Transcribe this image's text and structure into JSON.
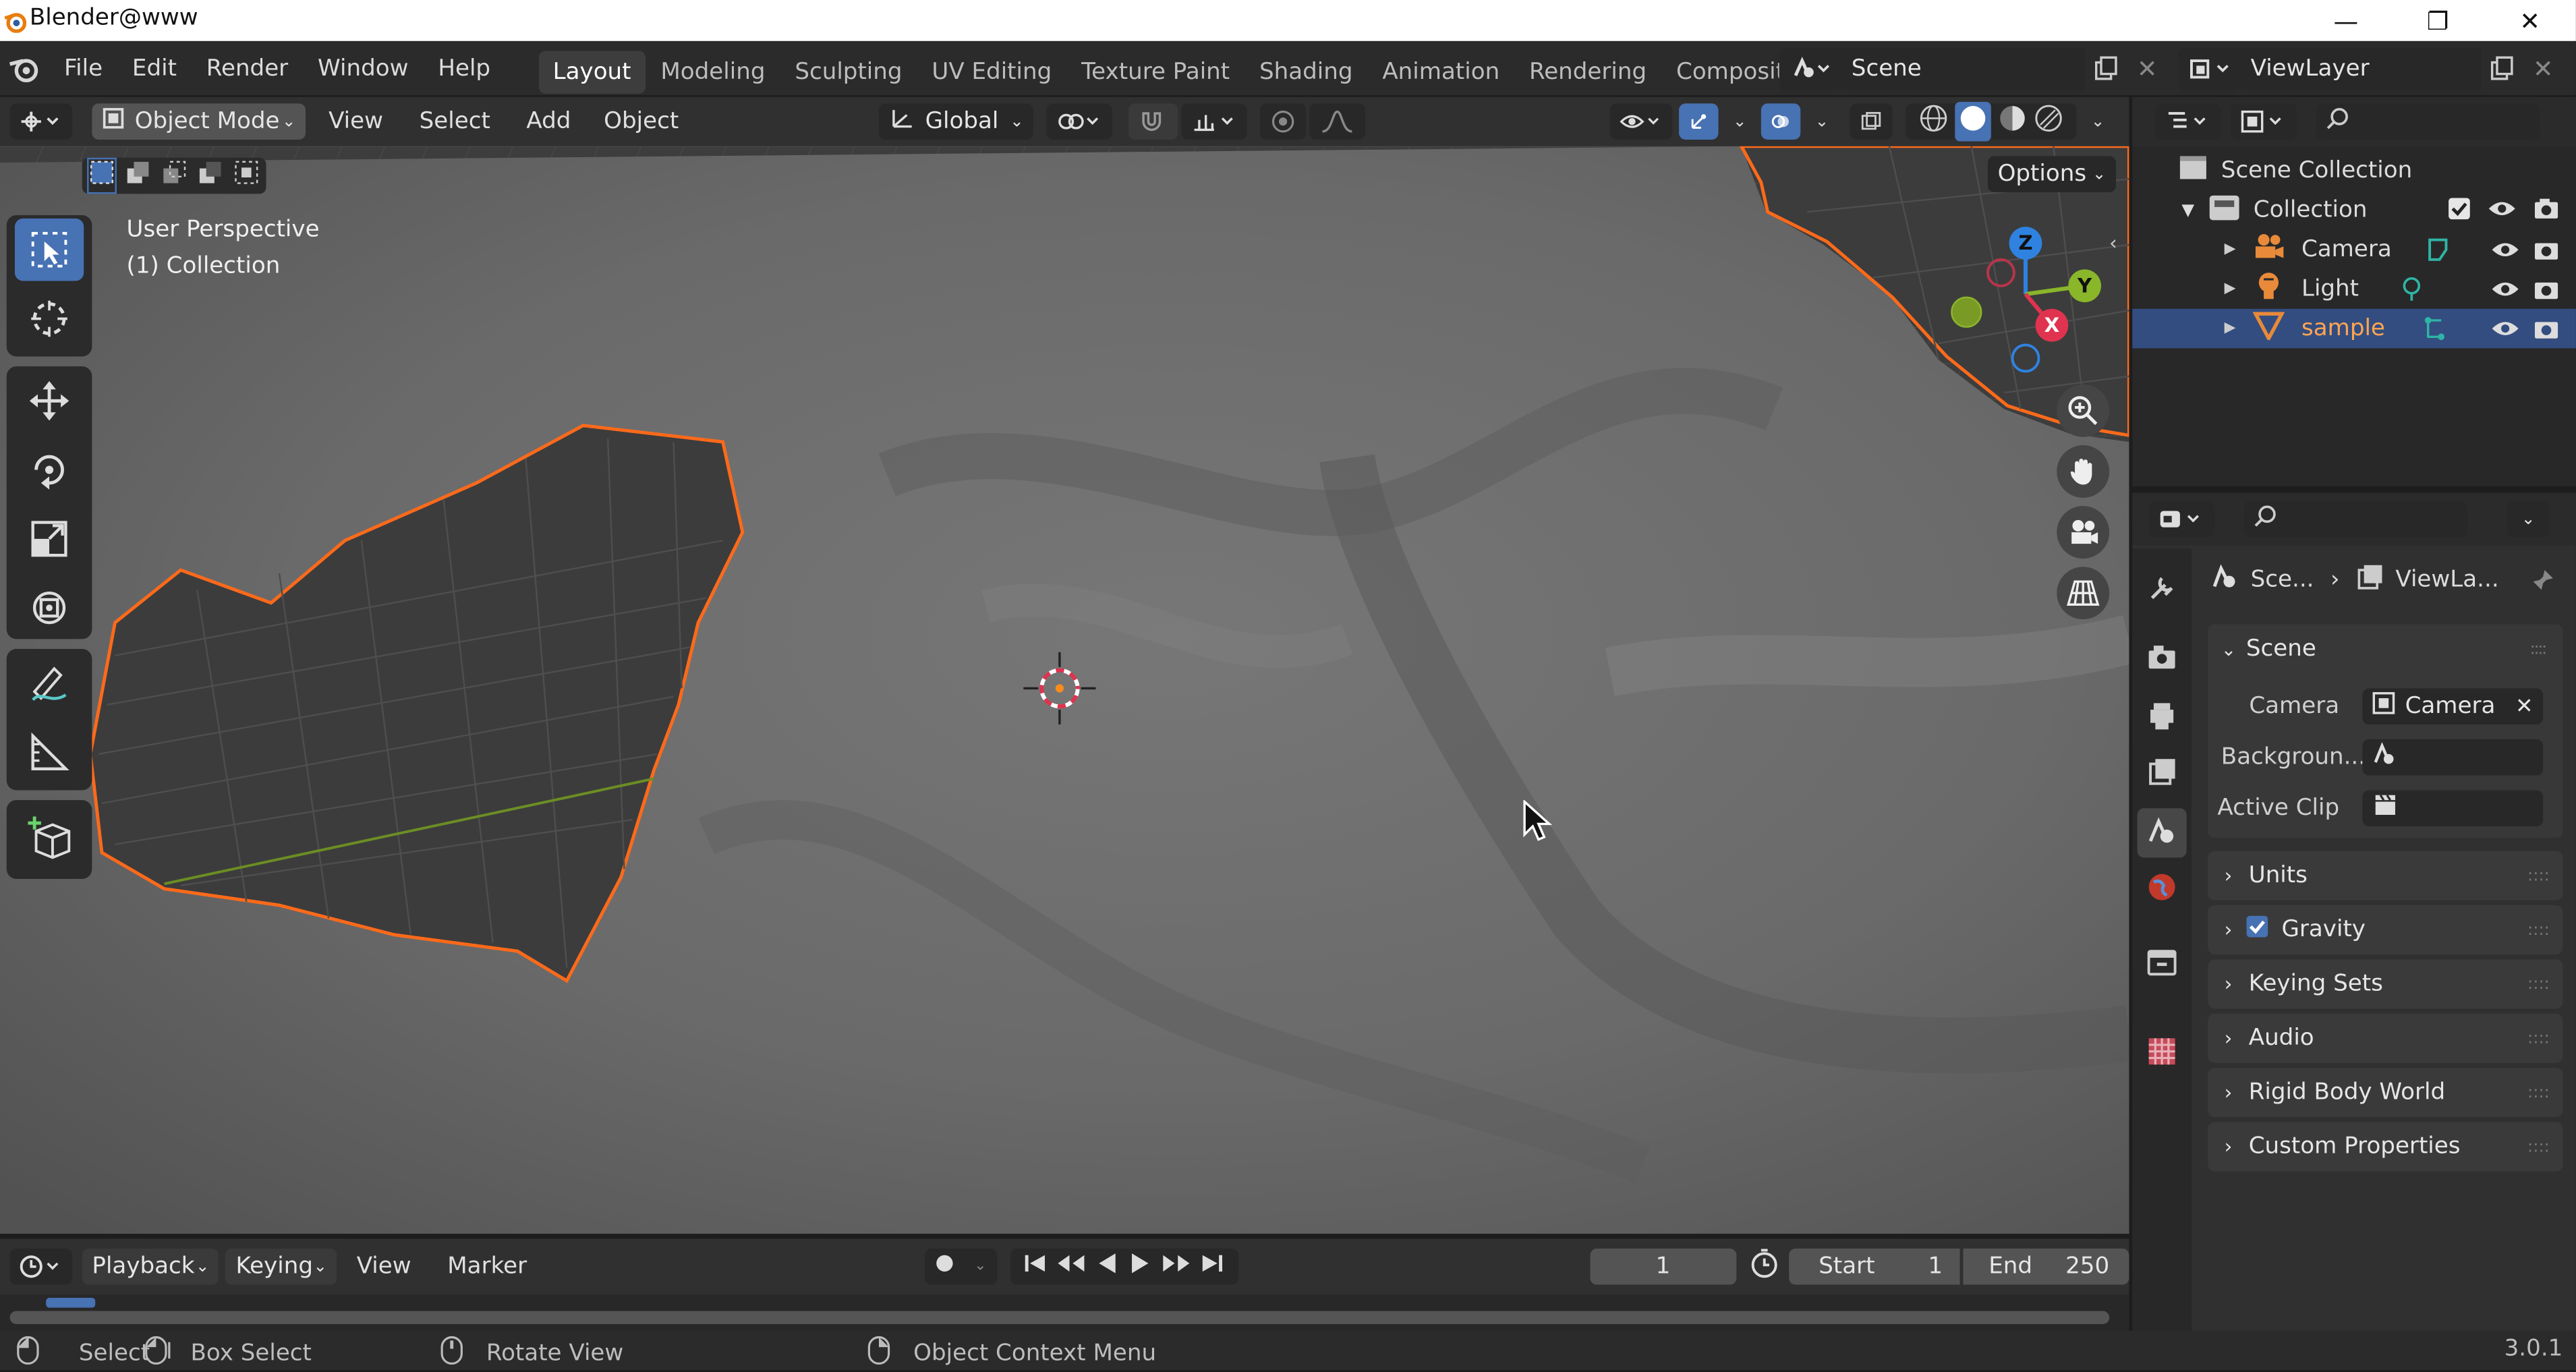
{
  "window": {
    "title": "Blender@www",
    "minimize": "—",
    "maximize": "❐",
    "close": "✕"
  },
  "menubar": {
    "items": [
      "File",
      "Edit",
      "Render",
      "Window",
      "Help"
    ],
    "workspaces": [
      "Layout",
      "Modeling",
      "Sculpting",
      "UV Editing",
      "Texture Paint",
      "Shading",
      "Animation",
      "Rendering",
      "Compositing"
    ],
    "active_workspace": "Layout",
    "scene_name": "Scene",
    "view_layer": "ViewLayer"
  },
  "viewport_header": {
    "mode": "Object Mode",
    "menus": [
      "View",
      "Select",
      "Add",
      "Object"
    ],
    "orientation": "Global",
    "options_label": "Options"
  },
  "viewport": {
    "perspective_label": "User Perspective",
    "collection_label": "(1) Collection",
    "gizmo_axes": {
      "z": "Z",
      "y": "Y",
      "x": "X"
    },
    "colors": {
      "x": "#e0334f",
      "y": "#8ab62a",
      "z": "#2f82e0",
      "selection": "#ff6a1a",
      "accent": "#4772b3"
    }
  },
  "outliner": {
    "root": "Scene Collection",
    "collection": "Collection",
    "objects": [
      {
        "name": "Camera",
        "type": "camera"
      },
      {
        "name": "Light",
        "type": "light"
      },
      {
        "name": "sample",
        "type": "mesh",
        "selected": true
      }
    ]
  },
  "properties": {
    "breadcrumb": [
      "Sce...",
      "ViewLa..."
    ],
    "panel_title": "Scene",
    "fields": [
      {
        "label": "Camera",
        "value": "Camera"
      },
      {
        "label": "Backgroun...",
        "value": ""
      },
      {
        "label": "Active Clip",
        "value": ""
      }
    ],
    "collapsed_panels": [
      "Units",
      "Gravity",
      "Keying Sets",
      "Audio",
      "Rigid Body World",
      "Custom Properties"
    ],
    "gravity_checked": true
  },
  "timeline": {
    "menus": [
      "Playback",
      "Keying",
      "View",
      "Marker"
    ],
    "current_frame": "1",
    "start_label": "Start",
    "start_value": "1",
    "end_label": "End",
    "end_value": "250"
  },
  "statusbar": {
    "select": "Select",
    "box_select": "Box Select",
    "rotate_view": "Rotate View",
    "context_menu": "Object Context Menu",
    "version": "3.0.1"
  }
}
